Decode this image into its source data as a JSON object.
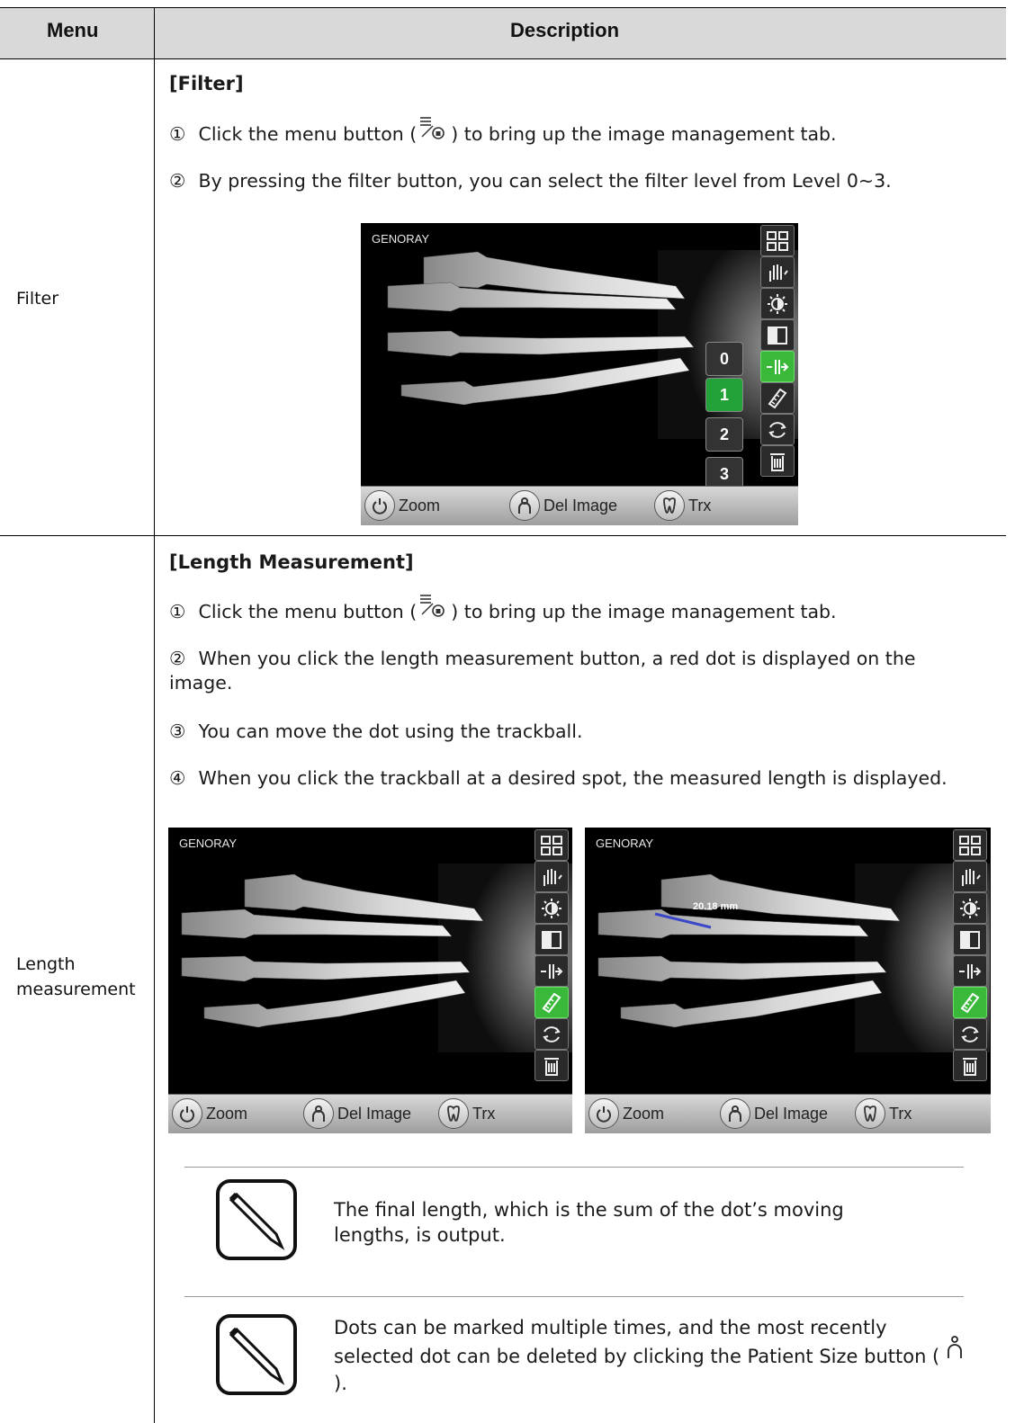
{
  "header": {
    "menu": "Menu",
    "description": "Description"
  },
  "filter": {
    "menu_label": "Filter",
    "title": "[Filter]",
    "steps": [
      {
        "num": "①",
        "before": "Click the menu button (",
        "after": ") to bring up the image management tab."
      },
      {
        "num": "②",
        "text": "By pressing the filter button, you can select the filter level from Level 0~3."
      }
    ],
    "screen": {
      "brand": "GENORAY",
      "levels": [
        "0",
        "1",
        "2",
        "3"
      ],
      "selected_level": "1",
      "active_tool": "filter-icon",
      "bottom": [
        "Zoom",
        "Del Image",
        "Trx"
      ]
    }
  },
  "length": {
    "menu_label": "Length measurement",
    "title": "[Length Measurement]",
    "steps": [
      {
        "num": "①",
        "before": "Click the menu button (",
        "after": ") to bring up the image management tab."
      },
      {
        "num": "②",
        "text": "When you click the length measurement button, a red dot is displayed on the image."
      },
      {
        "num": "③",
        "text": "You can move the dot using the trackball."
      },
      {
        "num": "④",
        "text": "When you click the trackball at a desired spot, the measured length is displayed."
      }
    ],
    "screen_left": {
      "brand": "GENORAY",
      "active_tool": "ruler-icon",
      "bottom": [
        "Zoom",
        "Del Image",
        "Trx"
      ]
    },
    "screen_right": {
      "brand": "GENORAY",
      "measurement": "20.18 mm",
      "active_tool": "ruler-icon",
      "bottom": [
        "Zoom",
        "Del Image",
        "Trx"
      ]
    },
    "notes": [
      {
        "text": "The final length, which is the sum of the dot’s moving lengths, is output."
      },
      {
        "before": "Dots can be marked multiple times, and the most recently selected dot can be deleted by clicking the Patient Size button (",
        "after": ")."
      }
    ]
  },
  "colors": {
    "header_bg": "#d9d9d9",
    "active_green": "#3ab83a",
    "measure_line": "#3a48c8"
  },
  "icons": [
    "menu-lock-icon",
    "grid-icon",
    "hand-icon",
    "brightness-icon",
    "contrast-icon",
    "filter-icon",
    "ruler-icon",
    "rotate-icon",
    "trash-icon",
    "power-icon",
    "person-icon",
    "tooth-icon",
    "pencil-note-icon"
  ]
}
